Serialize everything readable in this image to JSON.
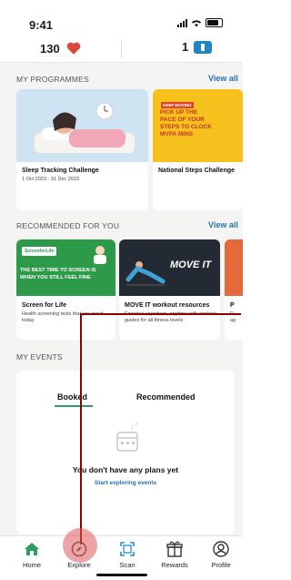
{
  "status_bar": {
    "time": "9:41"
  },
  "header": {
    "points": "130",
    "tickets": "1"
  },
  "programmes": {
    "title": "MY PROGRAMMES",
    "view_all": "View all",
    "cards": [
      {
        "title": "Sleep Tracking Challenge",
        "dates": "1 Oct 2023 - 31 Dec 2023"
      },
      {
        "title": "National Steps Challenge",
        "banner_tag": "KEEP MOVING",
        "banner_text": "PICK UP THE PACE OF YOUR STEPS TO CLOCK MVPA MINS"
      }
    ]
  },
  "recommended": {
    "title": "RECOMMENDED FOR YOU",
    "view_all": "View all",
    "cards": [
      {
        "title": "Screen for Life",
        "desc": "Health screening tests that you need today",
        "banner_logo": "ScreenforLife",
        "banner_text": "THE BEST TIME TO SCREEN IS WHEN YOU STILL FEEL FINE"
      },
      {
        "title": "MOVE IT workout resources",
        "desc": "Exercise anywhere, anytime with workout guides for all fitness levels",
        "banner_text": "MOVE IT"
      },
      {
        "title": "P",
        "desc": "Fi ag"
      }
    ]
  },
  "events": {
    "title": "MY EVENTS",
    "tabs": [
      {
        "label": "Booked",
        "active": true
      },
      {
        "label": "Recommended",
        "active": false
      }
    ],
    "empty_title": "You don't have any plans yet",
    "empty_link": "Start exploring events"
  },
  "nav": {
    "items": [
      {
        "label": "Home",
        "icon": "home-icon"
      },
      {
        "label": "Explore",
        "icon": "compass-icon"
      },
      {
        "label": "Scan",
        "icon": "scan-icon"
      },
      {
        "label": "Rewards",
        "icon": "gift-icon"
      },
      {
        "label": "Profile",
        "icon": "profile-icon"
      }
    ]
  },
  "colors": {
    "accent_green": "#2f9e62",
    "link_blue": "#2a6fb3",
    "heart_red": "#d9483b",
    "annotation": "#8b0000"
  }
}
